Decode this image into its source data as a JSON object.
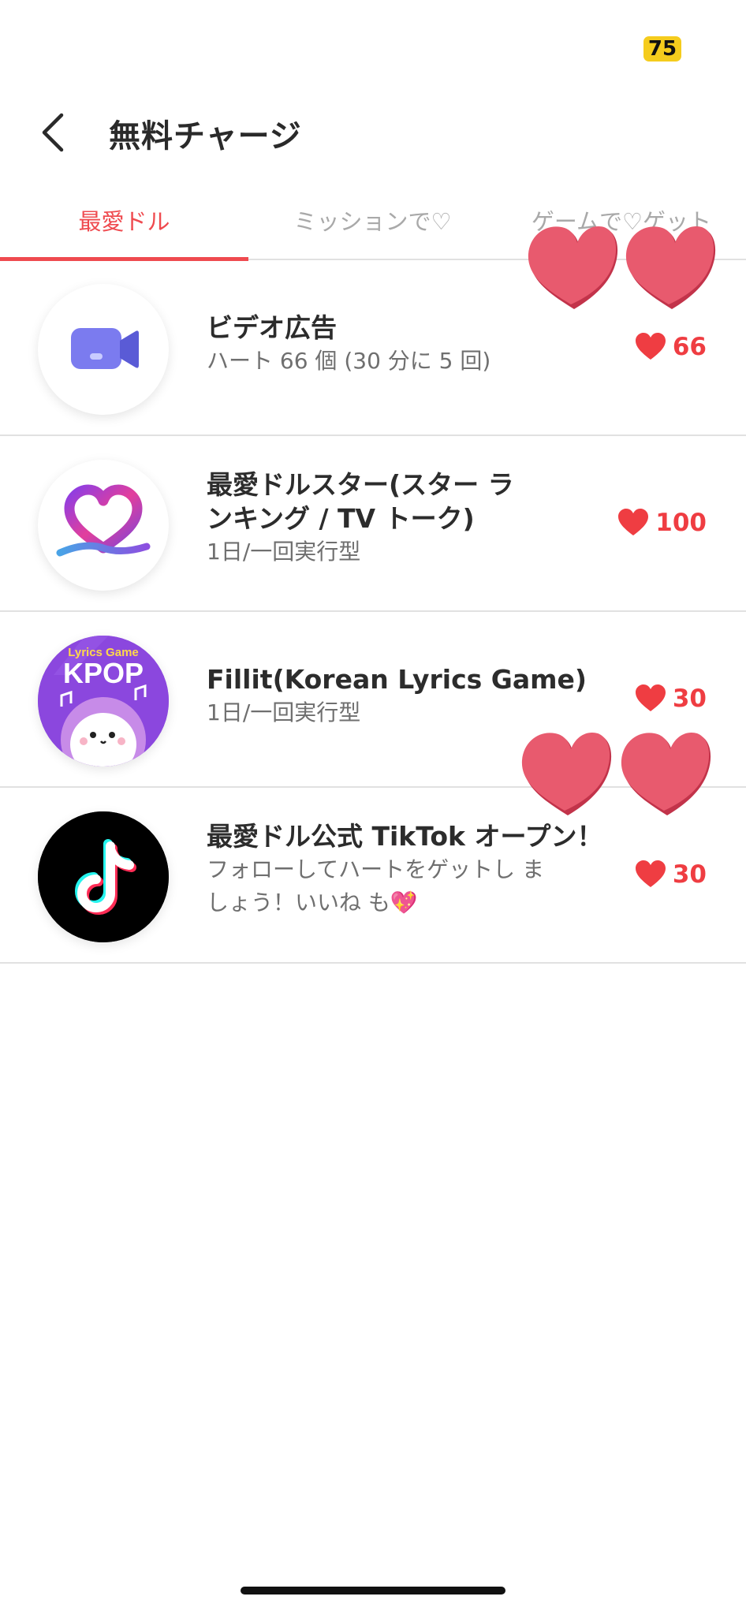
{
  "status_bar": {
    "battery": "75"
  },
  "header": {
    "title": "無料チャージ"
  },
  "tabs": [
    {
      "label": "最愛ドル",
      "active": true
    },
    {
      "label": "ミッションで♡",
      "active": false
    },
    {
      "label": "ゲームで♡ゲット",
      "active": false
    }
  ],
  "items": [
    {
      "icon": "video-camera-icon",
      "title": "ビデオ広告",
      "subtitle": "ハート 66 個 (30 分に 5 回)",
      "reward": "66"
    },
    {
      "icon": "saiaidol-star-logo",
      "title": "最愛ドルスター(スター ランキング / TV トーク)",
      "subtitle": "1日/一回実行型",
      "reward": "100"
    },
    {
      "icon": "kpop-lyrics-game-logo",
      "logo_text_top": "Lyrics Game",
      "logo_text_main": "KPOP",
      "title": "Fillit(Korean Lyrics Game)",
      "subtitle": "1日/一回実行型",
      "reward": "30"
    },
    {
      "icon": "tiktok-logo",
      "title": "最愛ドル公式 TikTok オープン！",
      "subtitle": "フォローしてハートをゲットし ましょう！いいね も💖",
      "reward": "30"
    }
  ],
  "colors": {
    "accent": "#ef4a4f",
    "heart": "#ef3d42",
    "float_heart": "#e85a6e",
    "battery": "#f5cc1d"
  }
}
